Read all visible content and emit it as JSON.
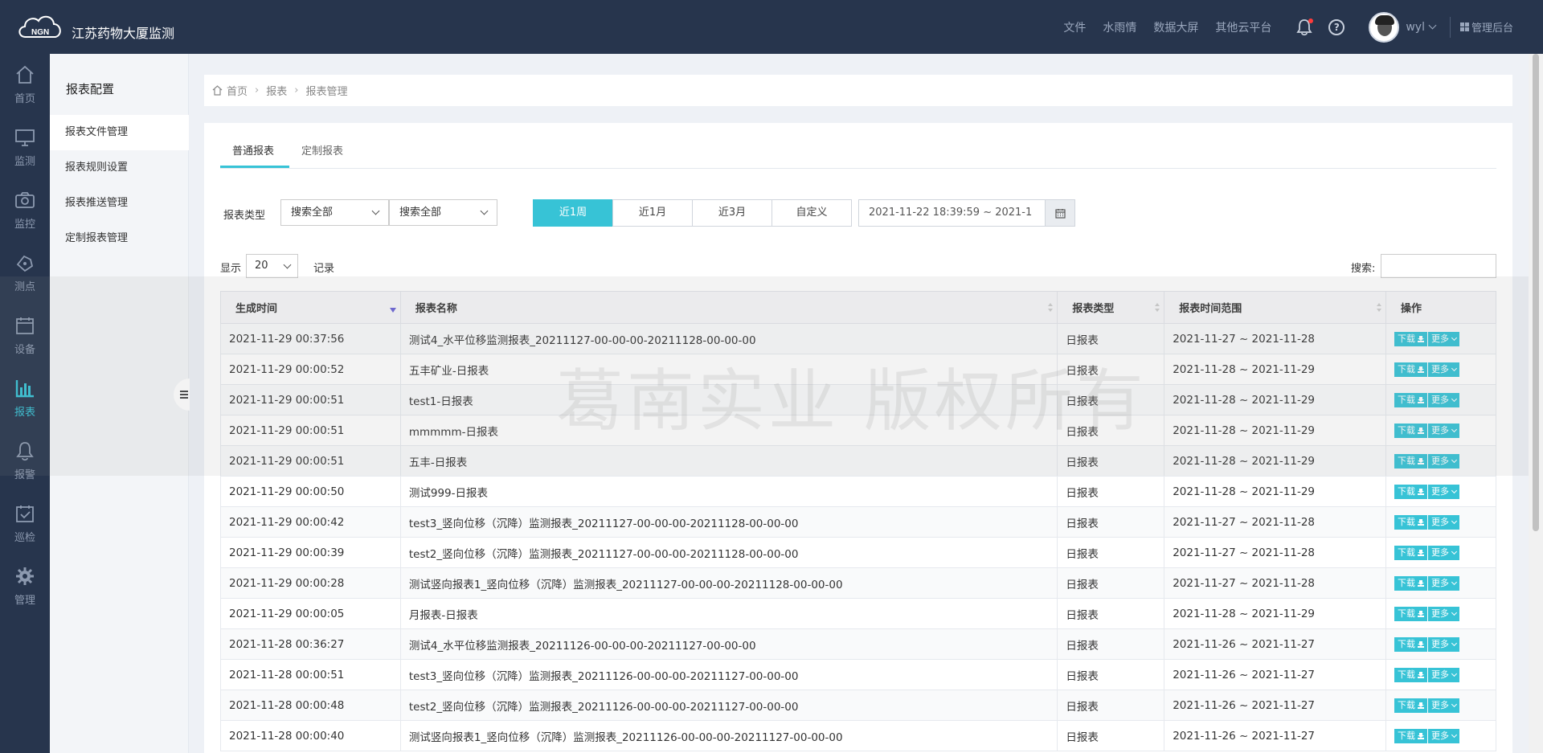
{
  "app": {
    "logo_text": "NGN",
    "title": "江苏药物大厦监测"
  },
  "topnav": {
    "links": [
      "文件",
      "水雨情",
      "数据大屏",
      "其他云平台"
    ],
    "user": "wyl",
    "admin": "管理后台"
  },
  "iconbar": [
    {
      "label": "首页",
      "icon": "home-icon"
    },
    {
      "label": "监测",
      "icon": "monitor-icon"
    },
    {
      "label": "监控",
      "icon": "camera-icon"
    },
    {
      "label": "测点",
      "icon": "point-icon"
    },
    {
      "label": "设备",
      "icon": "device-icon"
    },
    {
      "label": "报表",
      "icon": "chart-icon",
      "active": true
    },
    {
      "label": "报警",
      "icon": "bell-icon"
    },
    {
      "label": "巡检",
      "icon": "inspect-icon"
    },
    {
      "label": "管理",
      "icon": "gear-icon"
    }
  ],
  "subside": {
    "title": "报表配置",
    "items": [
      "报表文件管理",
      "报表规则设置",
      "报表推送管理",
      "定制报表管理"
    ]
  },
  "breadcrumb": [
    "首页",
    "报表",
    "报表管理"
  ],
  "tabs": [
    "普通报表",
    "定制报表"
  ],
  "filter": {
    "type_label": "报表类型",
    "select1": "搜索全部",
    "select2": "搜索全部",
    "ranges": [
      "近1周",
      "近1月",
      "近3月",
      "自定义"
    ],
    "date_range": "2021-11-22 18:39:59 ~ 2021-1"
  },
  "pager": {
    "show_label": "显示",
    "page_size": "20",
    "records_label": "记录",
    "search_label": "搜索:"
  },
  "table": {
    "headers": [
      "生成时间",
      "报表名称",
      "报表类型",
      "报表时间范围",
      "操作"
    ],
    "download_label": "下载",
    "more_label": "更多",
    "rows": [
      {
        "time": "2021-11-29 00:37:56",
        "name": "测试4_水平位移监测报表_20211127-00-00-00-20211128-00-00-00",
        "type": "日报表",
        "range": "2021-11-27 ~ 2021-11-28"
      },
      {
        "time": "2021-11-29 00:00:52",
        "name": "五丰矿业-日报表",
        "type": "日报表",
        "range": "2021-11-28 ~ 2021-11-29"
      },
      {
        "time": "2021-11-29 00:00:51",
        "name": "test1-日报表",
        "type": "日报表",
        "range": "2021-11-28 ~ 2021-11-29"
      },
      {
        "time": "2021-11-29 00:00:51",
        "name": "mmmmm-日报表",
        "type": "日报表",
        "range": "2021-11-28 ~ 2021-11-29"
      },
      {
        "time": "2021-11-29 00:00:51",
        "name": "五丰-日报表",
        "type": "日报表",
        "range": "2021-11-28 ~ 2021-11-29"
      },
      {
        "time": "2021-11-29 00:00:50",
        "name": "测试999-日报表",
        "type": "日报表",
        "range": "2021-11-28 ~ 2021-11-29"
      },
      {
        "time": "2021-11-29 00:00:42",
        "name": "test3_竖向位移（沉降）监测报表_20211127-00-00-00-20211128-00-00-00",
        "type": "日报表",
        "range": "2021-11-27 ~ 2021-11-28"
      },
      {
        "time": "2021-11-29 00:00:39",
        "name": "test2_竖向位移（沉降）监测报表_20211127-00-00-00-20211128-00-00-00",
        "type": "日报表",
        "range": "2021-11-27 ~ 2021-11-28"
      },
      {
        "time": "2021-11-29 00:00:28",
        "name": "测试竖向报表1_竖向位移（沉降）监测报表_20211127-00-00-00-20211128-00-00-00",
        "type": "日报表",
        "range": "2021-11-27 ~ 2021-11-28"
      },
      {
        "time": "2021-11-29 00:00:05",
        "name": "月报表-日报表",
        "type": "日报表",
        "range": "2021-11-28 ~ 2021-11-29"
      },
      {
        "time": "2021-11-28 00:36:27",
        "name": "测试4_水平位移监测报表_20211126-00-00-00-20211127-00-00-00",
        "type": "日报表",
        "range": "2021-11-26 ~ 2021-11-27"
      },
      {
        "time": "2021-11-28 00:00:51",
        "name": "test3_竖向位移（沉降）监测报表_20211126-00-00-00-20211127-00-00-00",
        "type": "日报表",
        "range": "2021-11-26 ~ 2021-11-27"
      },
      {
        "time": "2021-11-28 00:00:48",
        "name": "test2_竖向位移（沉降）监测报表_20211126-00-00-00-20211127-00-00-00",
        "type": "日报表",
        "range": "2021-11-26 ~ 2021-11-27"
      },
      {
        "time": "2021-11-28 00:00:40",
        "name": "测试竖向报表1_竖向位移（沉降）监测报表_20211126-00-00-00-20211127-00-00-00",
        "type": "日报表",
        "range": "2021-11-26 ~ 2021-11-27"
      }
    ]
  },
  "watermark": "葛南实业 版权所有",
  "colors": {
    "accent": "#37c3d6",
    "nav_bg": "#27354d",
    "sort_active": "#6a63d6"
  }
}
